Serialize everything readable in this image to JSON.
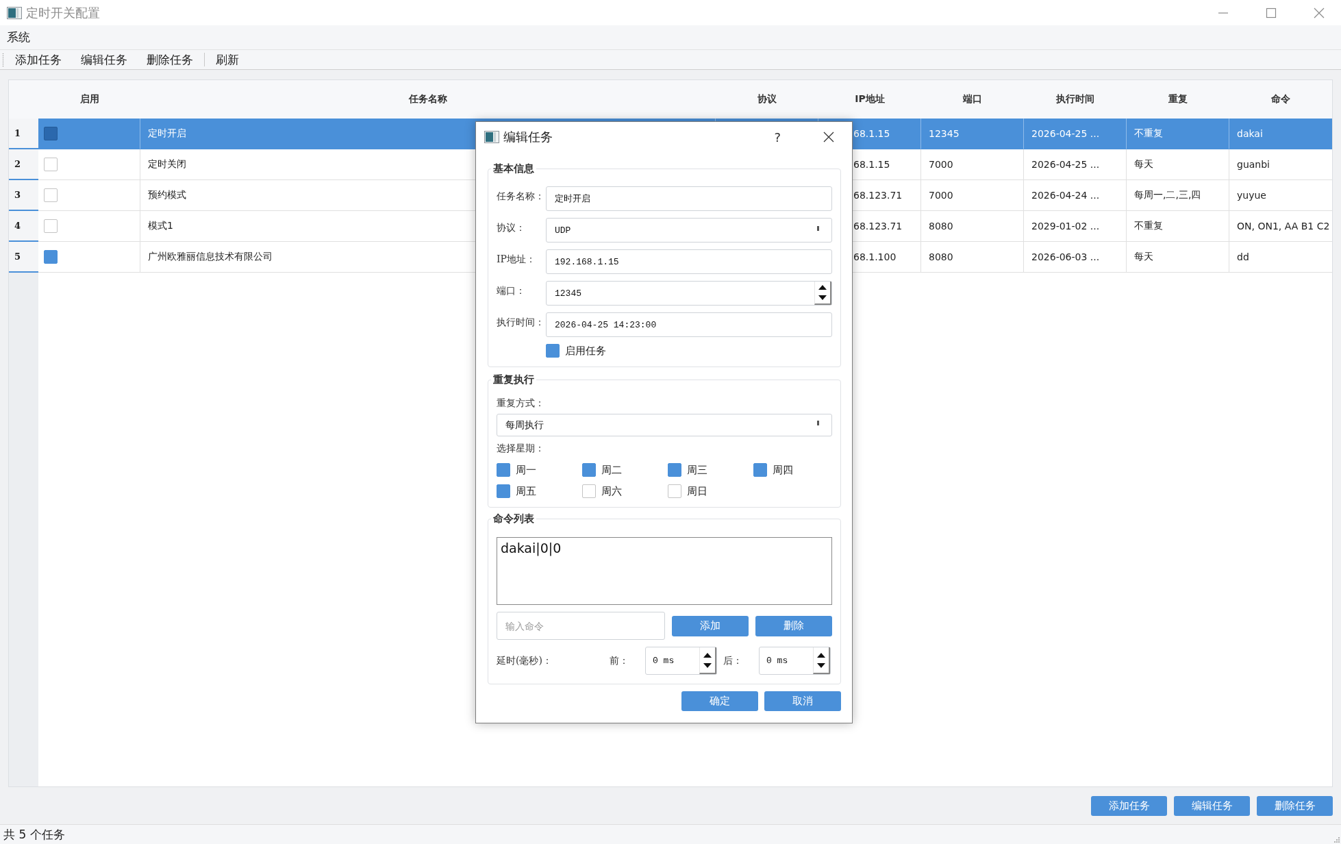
{
  "window": {
    "title": "定时开关配置"
  },
  "menu_bar": [
    "系统"
  ],
  "toolbar": [
    {
      "kind": "button",
      "label": "添加任务"
    },
    {
      "kind": "button",
      "label": "编辑任务"
    },
    {
      "kind": "button",
      "label": "删除任务"
    },
    {
      "kind": "separator"
    },
    {
      "kind": "button",
      "label": "刷新"
    }
  ],
  "table": {
    "columns": [
      "启用",
      "任务名称",
      "协议",
      "IP地址",
      "端口",
      "执行时间",
      "重复",
      "命令"
    ],
    "rows": [
      {
        "number": "1",
        "selected": true,
        "enabled": true,
        "name": "定时开启",
        "ip": "68.1.15",
        "port": "12345",
        "time": "2026-04-25 ...",
        "repeat": "不重复",
        "command": "dakai"
      },
      {
        "number": "2",
        "selected": false,
        "enabled": false,
        "name": "定时关闭",
        "ip": "68.1.15",
        "port": "7000",
        "time": "2026-04-25 ...",
        "repeat": "每天",
        "command": "guanbi"
      },
      {
        "number": "3",
        "selected": false,
        "enabled": false,
        "name": "预约模式",
        "ip": "68.123.71",
        "port": "7000",
        "time": "2026-04-24 ...",
        "repeat": "每周一,二,三,四",
        "command": "yuyue"
      },
      {
        "number": "4",
        "selected": false,
        "enabled": false,
        "name": "模式1",
        "ip": "68.123.71",
        "port": "8080",
        "time": "2029-01-02 ...",
        "repeat": "不重复",
        "command": "ON, ON1, AA B1 C2"
      },
      {
        "number": "5",
        "selected": false,
        "enabled": true,
        "name": "广州欧雅丽信息技术有限公司",
        "ip": "68.1.100",
        "port": "8080",
        "time": "2026-06-03 ...",
        "repeat": "每天",
        "command": "dd"
      }
    ]
  },
  "dialog": {
    "title": "编辑任务",
    "help": "?",
    "basic": {
      "title": "基本信息",
      "fields": [
        {
          "kind": "text",
          "label": "任务名称：",
          "value": "定时开启"
        },
        {
          "kind": "combo",
          "label": "协议：",
          "value": "UDP"
        },
        {
          "kind": "text",
          "label": "IP地址：",
          "value": "192.168.1.15"
        },
        {
          "kind": "spin",
          "label": "端口：",
          "value": "12345"
        },
        {
          "kind": "text",
          "label": "执行时间：",
          "value": "2026-04-25 14:23:00"
        }
      ],
      "enable": {
        "label": "启用任务",
        "checked": true
      }
    },
    "repeat": {
      "title": "重复执行",
      "mode_label": "重复方式：",
      "mode": "每周执行",
      "days_label": "选择星期：",
      "days": [
        {
          "label": "周一",
          "checked": true
        },
        {
          "label": "周二",
          "checked": true
        },
        {
          "label": "周三",
          "checked": true
        },
        {
          "label": "周四",
          "checked": true
        },
        {
          "label": "周五",
          "checked": true
        },
        {
          "label": "周六",
          "checked": false
        },
        {
          "label": "周日",
          "checked": false
        }
      ]
    },
    "commands": {
      "title": "命令列表",
      "items": [
        "dakai|0|0"
      ],
      "input": {
        "placeholder": "输入命令"
      },
      "buttons": [
        "添加",
        "删除"
      ],
      "delay_label": "延时(毫秒)：",
      "before": {
        "label": "前：",
        "value": "0 ms"
      },
      "after": {
        "label": "后：",
        "value": "0 ms"
      }
    },
    "actions": [
      "确定",
      "取消"
    ]
  },
  "buttons": [
    "添加任务",
    "编辑任务",
    "删除任务"
  ],
  "status_bar": {
    "text": "共 5 个任务"
  }
}
